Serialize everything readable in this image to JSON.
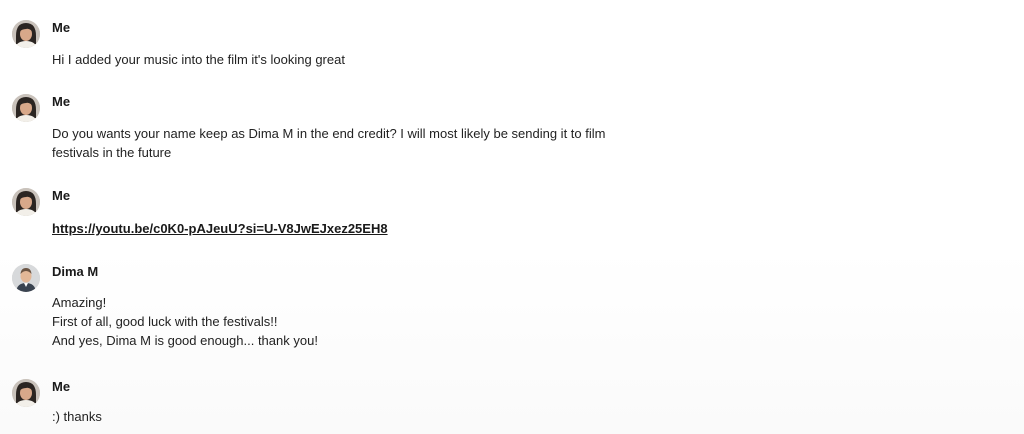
{
  "messages": [
    {
      "sender": "Me",
      "avatar": "me-avatar",
      "lines": [
        "Hi I added your music into the film it's looking great"
      ]
    },
    {
      "sender": "Me",
      "avatar": "me-avatar",
      "lines": [
        "Do you wants your name keep as Dima M in the end credit? I will most likely be sending it to film",
        "festivals in the future"
      ]
    },
    {
      "sender": "Me",
      "avatar": "me-avatar",
      "link": "https://youtu.be/c0K0-pAJeuU?si=U-V8JwEJxez25EH8"
    },
    {
      "sender": "Dima M",
      "avatar": "dima-avatar",
      "lines": [
        "Amazing!",
        "First of all, good luck with the festivals!!",
        "And yes, Dima M is good enough... thank you!"
      ]
    },
    {
      "sender": "Me",
      "avatar": "me-avatar",
      "lines": [
        ":) thanks"
      ]
    }
  ],
  "colors": {
    "text": "#222222",
    "sender": "#1a1a1a",
    "background": "#ffffff"
  }
}
